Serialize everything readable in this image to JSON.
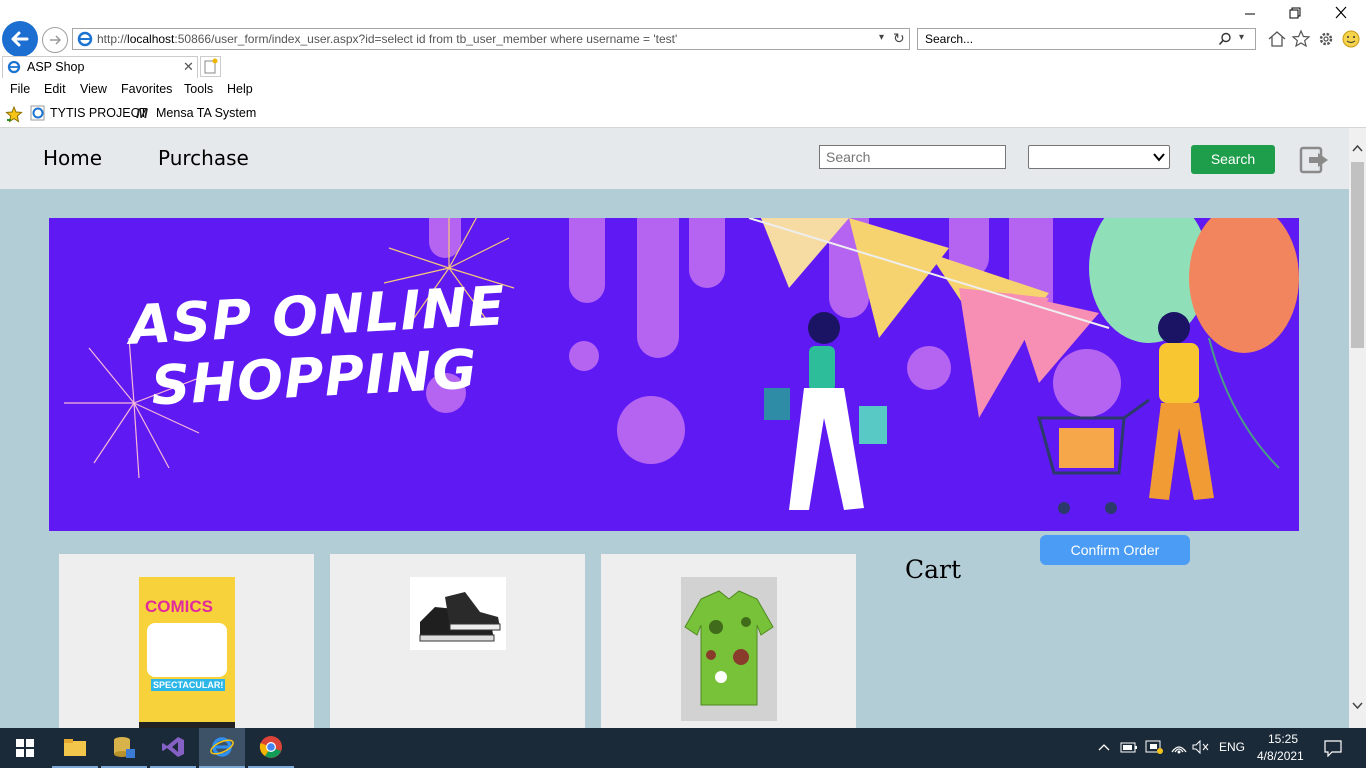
{
  "browser": {
    "address_host": "localhost",
    "address_prefix": "http://",
    "address_rest": ":50866/user_form/index_user.aspx?id=select id from tb_user_member where username =  'test'",
    "search_placeholder": "Search...",
    "tab_title": "ASP Shop",
    "menu": [
      "File",
      "Edit",
      "View",
      "Favorites",
      "Tools",
      "Help"
    ],
    "favorites": [
      "TYTIS PROJECT",
      "Mensa TA System"
    ]
  },
  "page": {
    "nav": {
      "home": "Home",
      "purchase": "Purchase"
    },
    "search_placeholder": "Search",
    "search_button": "Search",
    "banner": {
      "line1": "ASP ONLINE",
      "line2": "SHOPPING"
    },
    "confirm_button": "Confirm Order",
    "cart_title": "Cart",
    "products": [
      {
        "name": "comics-product",
        "comic_title": "COMICS",
        "comic_tag": "SPECTACULAR!"
      },
      {
        "name": "sneakers-product"
      },
      {
        "name": "shirt-product"
      }
    ]
  },
  "taskbar": {
    "language": "ENG",
    "time": "15:25",
    "date": "4/8/2021"
  },
  "colors": {
    "banner_bg": "#5f19f2",
    "page_bg": "#b3cdd7",
    "nav_bg": "#e6e9ec",
    "search_btn": "#1e9d4a",
    "confirm_btn": "#4a9cf4",
    "taskbar": "#1b2a38"
  }
}
